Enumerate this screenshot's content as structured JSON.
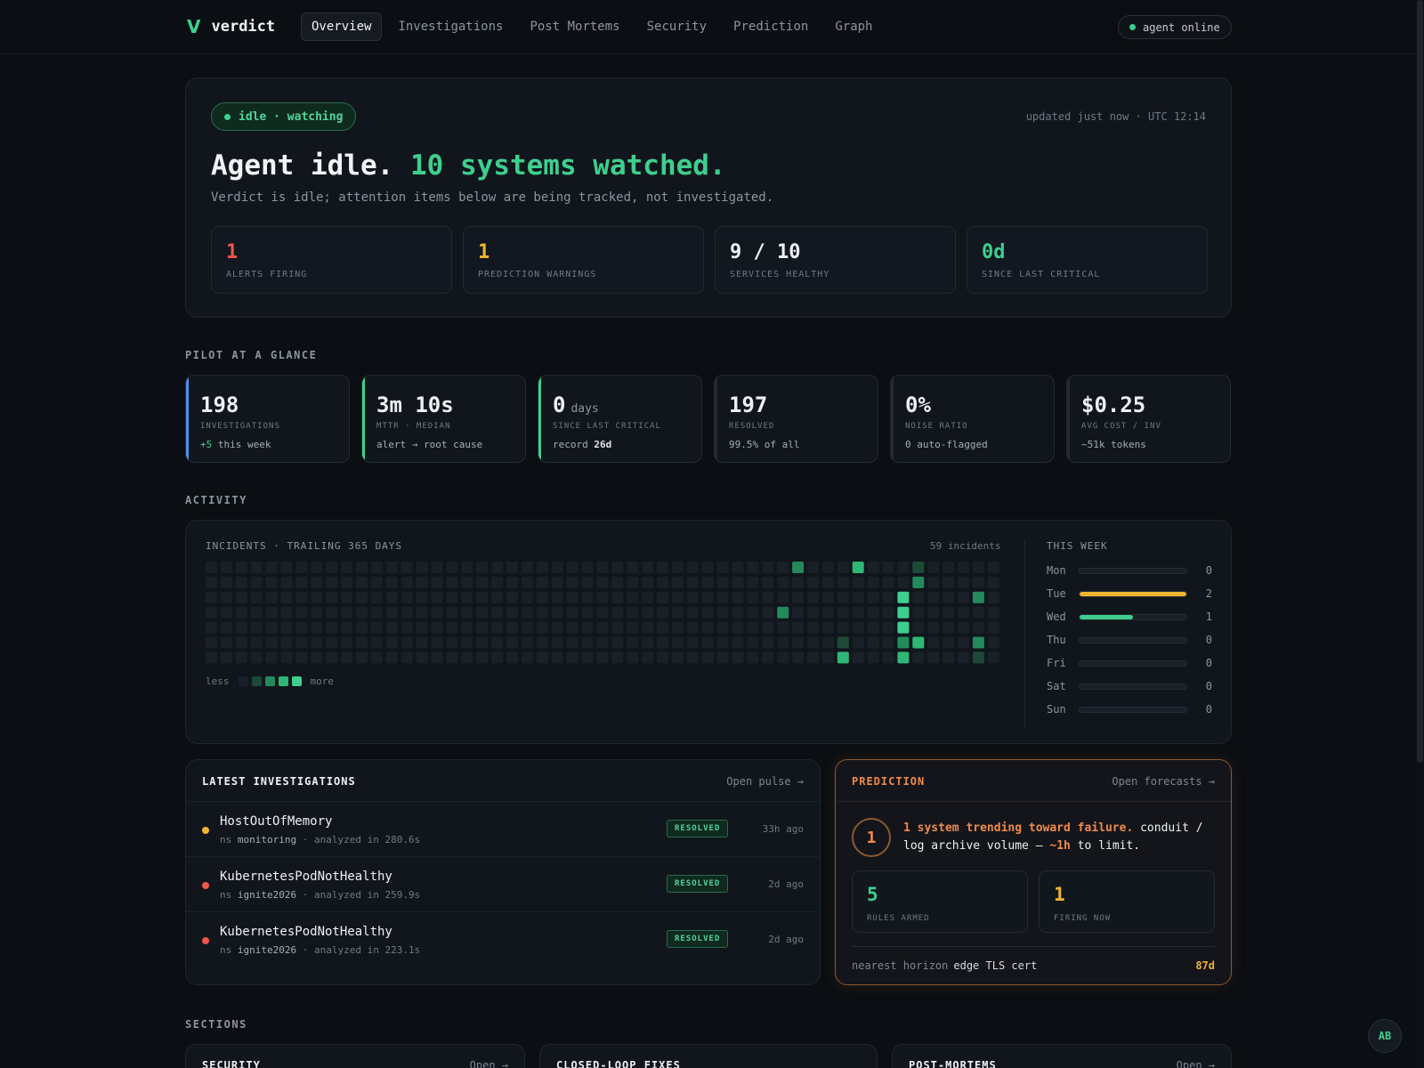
{
  "brand": {
    "mark": "V",
    "name": "verdict"
  },
  "nav": [
    {
      "label": "Overview",
      "active": true
    },
    {
      "label": "Investigations"
    },
    {
      "label": "Post Mortems"
    },
    {
      "label": "Security"
    },
    {
      "label": "Prediction"
    },
    {
      "label": "Graph"
    }
  ],
  "agent_status": "agent online",
  "hero": {
    "status": "idle · watching",
    "updated": "updated just now · UTC 12:14",
    "title_prefix": "Agent idle.",
    "title_accent": "10 systems watched.",
    "subtitle": "Verdict is idle; attention items below are being tracked, not investigated.",
    "stats": [
      {
        "value": "1",
        "label": "ALERTS FIRING",
        "color": "#f0564a"
      },
      {
        "value": "1",
        "label": "PREDICTION WARNINGS",
        "color": "#f0b430"
      },
      {
        "value": "9 / 10",
        "label": "SERVICES HEALTHY",
        "color": "#eef1f4"
      },
      {
        "value": "0d",
        "label": "SINCE LAST CRITICAL",
        "color": "#3ecf8e"
      }
    ]
  },
  "pilot": {
    "heading": "PILOT AT A GLANCE",
    "kpis": [
      {
        "value": "198",
        "unit": "",
        "label": "INVESTIGATIONS",
        "sub_accent": "+5",
        "sub": " this week",
        "sub_bold": "",
        "accent": "#4f8ff0"
      },
      {
        "value": "3m 10s",
        "unit": "",
        "label": "MTTR · MEDIAN",
        "sub_accent": "",
        "sub": "alert → root cause",
        "sub_bold": "",
        "accent": "#3ecf8e"
      },
      {
        "value": "0",
        "unit": "days",
        "label": "SINCE LAST CRITICAL",
        "sub_accent": "",
        "sub": "record ",
        "sub_bold": "26d",
        "accent": "#3ecf8e"
      },
      {
        "value": "197",
        "unit": "",
        "label": "RESOLVED",
        "sub_accent": "",
        "sub": "99.5% of all",
        "sub_bold": "",
        "accent": "#232a33"
      },
      {
        "value": "0%",
        "unit": "",
        "label": "NOISE RATIO",
        "sub_accent": "",
        "sub": "0 auto-flagged",
        "sub_bold": "",
        "accent": "#232a33"
      },
      {
        "value": "$0.25",
        "unit": "",
        "label": "AVG COST / INV",
        "sub_accent": "",
        "sub": "~51k tokens",
        "sub_bold": "",
        "accent": "#232a33"
      }
    ]
  },
  "activity": {
    "heading": "ACTIVITY",
    "incidents_title": "INCIDENTS · TRAILING 365 DAYS",
    "incidents_count": "59 incidents",
    "legend_less": "less",
    "legend_more": "more",
    "heat_colors": [
      "#1a2027",
      "#1d4a36",
      "#238a5c",
      "#2fb676",
      "#3ecf8e"
    ],
    "heat_cells": [
      {
        "week": 39,
        "day": 0,
        "level": 2
      },
      {
        "week": 38,
        "day": 3,
        "level": 2
      },
      {
        "week": 43,
        "day": 0,
        "level": 3
      },
      {
        "week": 42,
        "day": 5,
        "level": 1
      },
      {
        "week": 42,
        "day": 6,
        "level": 3
      },
      {
        "week": 46,
        "day": 2,
        "level": 4
      },
      {
        "week": 46,
        "day": 3,
        "level": 4
      },
      {
        "week": 46,
        "day": 4,
        "level": 4
      },
      {
        "week": 46,
        "day": 5,
        "level": 2
      },
      {
        "week": 46,
        "day": 6,
        "level": 3
      },
      {
        "week": 47,
        "day": 0,
        "level": 1
      },
      {
        "week": 47,
        "day": 1,
        "level": 2
      },
      {
        "week": 47,
        "day": 5,
        "level": 3
      },
      {
        "week": 51,
        "day": 2,
        "level": 2
      },
      {
        "week": 51,
        "day": 5,
        "level": 2
      },
      {
        "week": 51,
        "day": 6,
        "level": 1
      }
    ],
    "week_title": "THIS WEEK",
    "week": [
      {
        "day": "Mon",
        "count": 0,
        "color": "#3ecf8e"
      },
      {
        "day": "Tue",
        "count": 2,
        "color": "#f0b430"
      },
      {
        "day": "Wed",
        "count": 1,
        "color": "#3ecf8e"
      },
      {
        "day": "Thu",
        "count": 0,
        "color": "#3ecf8e"
      },
      {
        "day": "Fri",
        "count": 0,
        "color": "#3ecf8e"
      },
      {
        "day": "Sat",
        "count": 0,
        "color": "#3ecf8e"
      },
      {
        "day": "Sun",
        "count": 0,
        "color": "#3ecf8e"
      }
    ],
    "week_max": 2
  },
  "latest": {
    "title": "LATEST INVESTIGATIONS",
    "link": "Open pulse →",
    "items": [
      {
        "name": "HostOutOfMemory",
        "ns_label": "ns ",
        "ns": "monitoring",
        "detail": " · analyzed in 280.6s",
        "status": "RESOLVED",
        "ago": "33h ago",
        "dot": "#f0b430"
      },
      {
        "name": "KubernetesPodNotHealthy",
        "ns_label": "ns ",
        "ns": "ignite2026",
        "detail": " · analyzed in 259.9s",
        "status": "RESOLVED",
        "ago": "2d ago",
        "dot": "#f0564a"
      },
      {
        "name": "KubernetesPodNotHealthy",
        "ns_label": "ns ",
        "ns": "ignite2026",
        "detail": " · analyzed in 223.1s",
        "status": "RESOLVED",
        "ago": "2d ago",
        "dot": "#f0564a"
      }
    ]
  },
  "prediction": {
    "title": "PREDICTION",
    "link": "Open forecasts →",
    "count": "1",
    "text_accent": "1 system trending toward failure.",
    "text_main": " conduit / log archive volume — ",
    "text_eta": "~1h",
    "text_tail": " to limit.",
    "stats": [
      {
        "value": "5",
        "label": "RULES ARMED",
        "color": "#3ecf8e"
      },
      {
        "value": "1",
        "label": "FIRING NOW",
        "color": "#f0b430"
      }
    ],
    "horizon_label": "nearest horizon",
    "horizon_item": "edge TLS cert",
    "horizon_value": "87d"
  },
  "sections": {
    "heading": "SECTIONS",
    "cards": [
      {
        "title": "SECURITY",
        "link": "Open →"
      },
      {
        "title": "CLOSED-LOOP FIXES",
        "link": ""
      },
      {
        "title": "POST-MORTEMS",
        "link": "Open →"
      }
    ]
  },
  "avatar": "AB"
}
